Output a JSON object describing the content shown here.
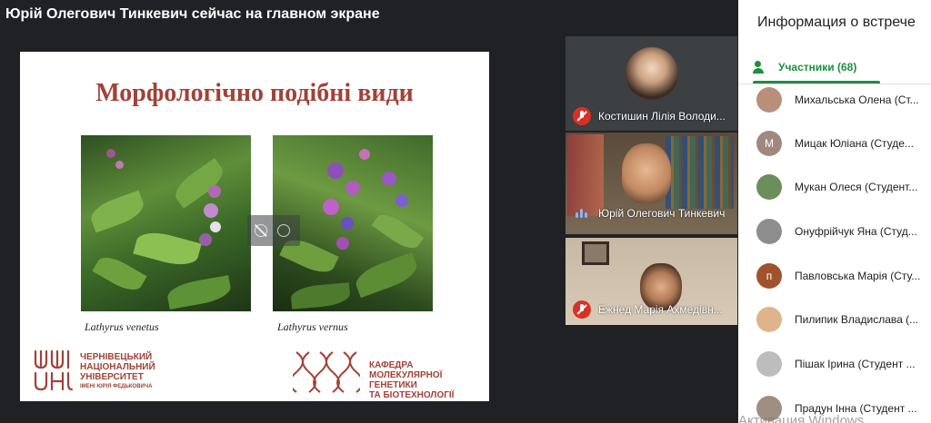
{
  "stage": {
    "presenter_banner": "Юрій Олегович Тинкевич сейчас на главном экране"
  },
  "slide": {
    "title": "Морфологічно подібні види",
    "captions": [
      "Lathyrus venetus",
      "Lathyrus vernus"
    ],
    "university_name": "ЧЕРНІВЕЦЬКИЙ\nНАЦІОНАЛЬНИЙ\nУНІВЕРСИТЕТ",
    "university_sub": "ІМЕНІ ЮРІЯ ФЕДЬКОВИЧА",
    "department_name": "КАФЕДРА\nМОЛЕКУЛЯРНОЇ ГЕНЕТИКИ\nТА БІОТЕХНОЛОГІЇ",
    "university_logo_letters": "ЧНУ"
  },
  "tiles": [
    {
      "name": "Костишин Лілія Володи...",
      "mic": "muted-icon"
    },
    {
      "name": "Юрій Олегович Тинкевич",
      "mic": "speaking-icon"
    },
    {
      "name": "Ежнед Марія Ахмедівн...",
      "mic": "muted-icon"
    }
  ],
  "panel": {
    "title": "Информация о встрече",
    "participants_tab": "Участники (68)",
    "participants": [
      {
        "name": "Михальська Олена (Ст...",
        "initial": "",
        "color": "#b98f7a"
      },
      {
        "name": "Мицак Юліана (Студе...",
        "initial": "М",
        "color": "#a1887f"
      },
      {
        "name": "Мукан Олеся (Студент...",
        "initial": "",
        "color": "#6b8e5a"
      },
      {
        "name": "Онуфрійчук Яна (Студ...",
        "initial": "",
        "color": "#8d8d8d"
      },
      {
        "name": "Павловська Марія (Сту...",
        "initial": "п",
        "color": "#a0522d"
      },
      {
        "name": "Пилипик Владислава (...",
        "initial": "",
        "color": "#e0b48a"
      },
      {
        "name": "Пішак Ірина (Студент ...",
        "initial": "",
        "color": "#bdbdbd"
      },
      {
        "name": "Прадун Інна (Студент ...",
        "initial": "",
        "color": "#9e8f80"
      }
    ]
  },
  "overlay": {
    "activation_text": "Активация Windows"
  }
}
